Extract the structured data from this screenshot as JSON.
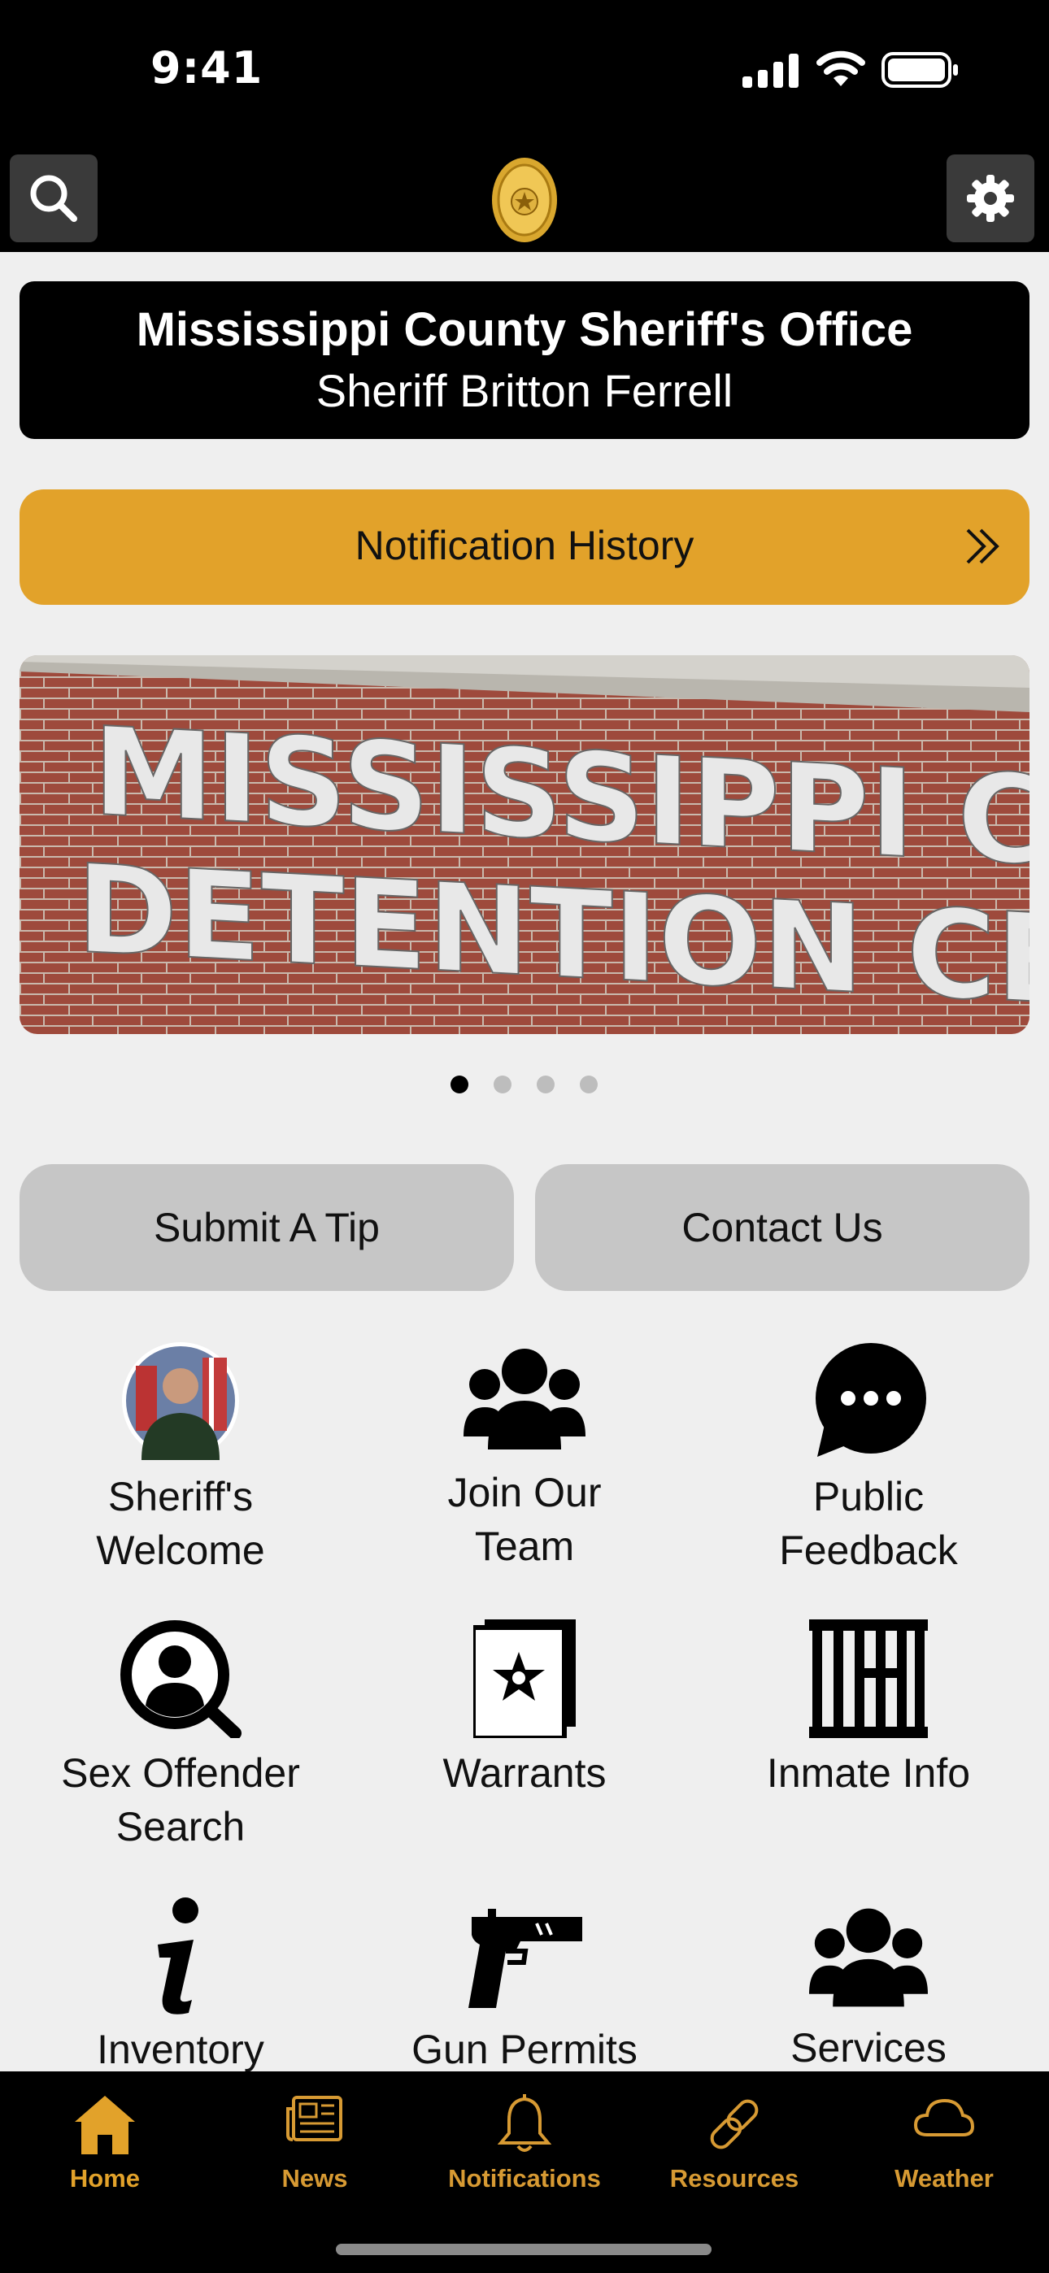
{
  "status_bar": {
    "time": "9:41"
  },
  "header": {
    "search_icon": "search-icon",
    "logo": "sheriff-badge-logo",
    "settings_icon": "gear-icon"
  },
  "title_card": {
    "title": "Mississippi County Sheriff's Office",
    "subtitle": "Sheriff Britton Ferrell"
  },
  "notification_bar": {
    "label": "Notification History",
    "icon": "double-chevron-right-icon"
  },
  "banner": {
    "line1": "MISSISSIPPI COUNTY",
    "line2": "DETENTION CENTER",
    "carousel": {
      "count": 4,
      "active": 0
    }
  },
  "actions": {
    "tip": "Submit A Tip",
    "contact": "Contact Us"
  },
  "grid": [
    {
      "label_1": "Sheriff's",
      "label_2": "Welcome",
      "icon": "sheriff-photo-avatar"
    },
    {
      "label_1": "Join Our",
      "label_2": "Team",
      "icon": "group-icon"
    },
    {
      "label_1": "Public",
      "label_2": "Feedback",
      "icon": "chat-bubble-icon"
    },
    {
      "label_1": "Sex Offender",
      "label_2": "Search",
      "icon": "person-search-icon"
    },
    {
      "label_1": "Warrants",
      "icon": "warrant-badge-icon"
    },
    {
      "label_1": "Inmate Info",
      "icon": "jail-cell-icon"
    },
    {
      "label_1": "Inventory",
      "icon": "info-icon"
    },
    {
      "label_1": "Gun Permits",
      "icon": "gun-icon"
    },
    {
      "label_1": "Services",
      "icon": "group-icon"
    }
  ],
  "tabs": [
    {
      "label": "Home",
      "icon": "home-icon",
      "active": true
    },
    {
      "label": "News",
      "icon": "newspaper-icon"
    },
    {
      "label": "Notifications",
      "icon": "bell-icon"
    },
    {
      "label": "Resources",
      "icon": "link-icon"
    },
    {
      "label": "Weather",
      "icon": "cloud-icon"
    }
  ],
  "colors": {
    "accent": "#E2A22A",
    "tab_active": "#E2A22A",
    "tab_inactive": "#D79A33",
    "background": "#EFEFEF",
    "pill": "#C6C6C6"
  }
}
